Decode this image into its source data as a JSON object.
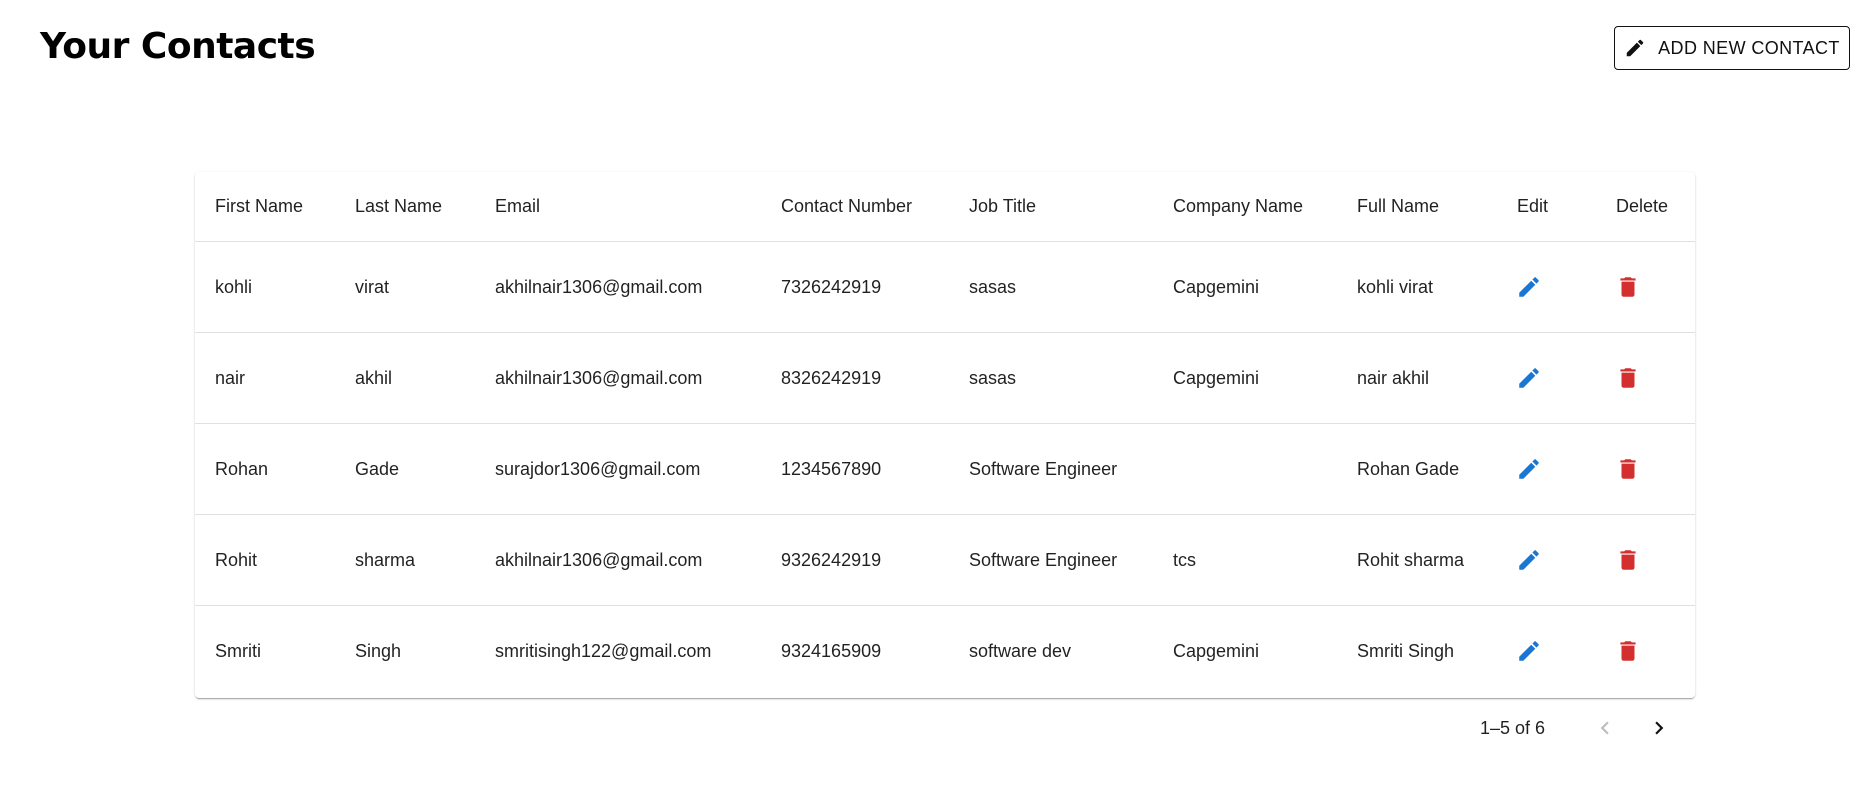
{
  "header": {
    "title": "Your Contacts",
    "add_button_label": "ADD NEW CONTACT",
    "add_button_icon": "pencil-icon"
  },
  "table": {
    "columns": [
      "First Name",
      "Last Name",
      "Email",
      "Contact Number",
      "Job Title",
      "Company Name",
      "Full Name",
      "Edit",
      "Delete"
    ],
    "rows": [
      {
        "first_name": "kohli",
        "last_name": "virat",
        "email": "akhilnair1306@gmail.com",
        "contact_number": "7326242919",
        "job_title": "sasas",
        "company_name": "Capgemini",
        "full_name": "kohli virat"
      },
      {
        "first_name": "nair",
        "last_name": "akhil",
        "email": "akhilnair1306@gmail.com",
        "contact_number": "8326242919",
        "job_title": "sasas",
        "company_name": "Capgemini",
        "full_name": "nair akhil"
      },
      {
        "first_name": "Rohan",
        "last_name": "Gade",
        "email": "surajdor1306@gmail.com",
        "contact_number": "1234567890",
        "job_title": "Software Engineer",
        "company_name": "",
        "full_name": "Rohan Gade"
      },
      {
        "first_name": "Rohit",
        "last_name": "sharma",
        "email": "akhilnair1306@gmail.com",
        "contact_number": "9326242919",
        "job_title": "Software Engineer",
        "company_name": "tcs",
        "full_name": "Rohit sharma"
      },
      {
        "first_name": "Smriti",
        "last_name": "Singh",
        "email": "smritisingh122@gmail.com",
        "contact_number": "9324165909",
        "job_title": "software dev",
        "company_name": "Capgemini",
        "full_name": "Smriti Singh"
      }
    ],
    "edit_icon": "pencil-icon",
    "delete_icon": "trash-icon"
  },
  "pagination": {
    "range_label": "1–5 of 6",
    "prev_icon": "chevron-left-icon",
    "next_icon": "chevron-right-icon"
  },
  "colors": {
    "edit_icon": "#1976d2",
    "delete_icon": "#d32f2f",
    "disabled_icon": "#bdbdbd"
  }
}
